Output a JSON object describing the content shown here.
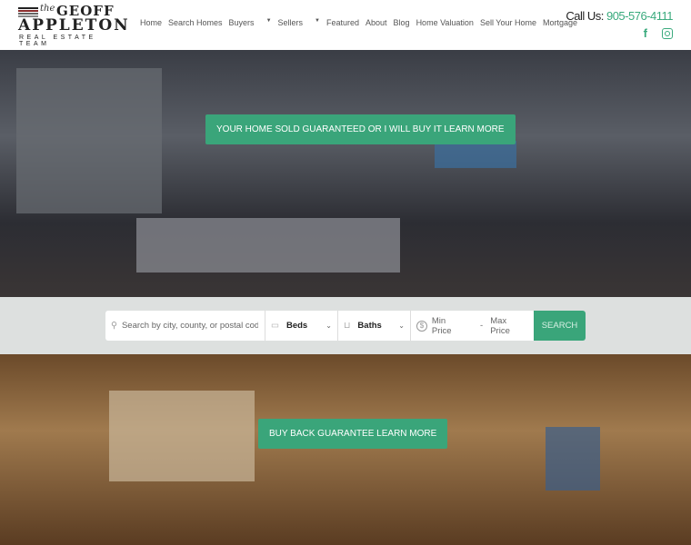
{
  "logo": {
    "the": "the",
    "name1": "GEOFF",
    "name2": "APPLETON",
    "sub": "REAL ESTATE TEAM"
  },
  "nav": [
    {
      "label": "Home"
    },
    {
      "label": "Search Homes"
    },
    {
      "label": "Buyers",
      "dropdown": true
    },
    {
      "label": "Sellers",
      "dropdown": true
    },
    {
      "label": "Featured"
    },
    {
      "label": "About"
    },
    {
      "label": "Blog"
    },
    {
      "label": "Home Valuation"
    },
    {
      "label": "Sell Your Home"
    },
    {
      "label": "Mortgage"
    }
  ],
  "contact": {
    "label": "Call Us:",
    "phone": "905-576-4111"
  },
  "social": [
    "facebook-icon",
    "instagram-icon"
  ],
  "hero1": {
    "cta": "YOUR HOME SOLD GUARANTEED OR I WILL BUY IT LEARN MORE"
  },
  "search": {
    "placeholder": "Search by city, county, or postal code",
    "beds": "Beds",
    "baths": "Baths",
    "min": "Min Price",
    "max": "Max Price",
    "dash": "-",
    "button": "SEARCH"
  },
  "hero2": {
    "cta": "BUY BACK GUARANTEE LEARN MORE"
  },
  "colors": {
    "accent": "#3aa57a"
  }
}
